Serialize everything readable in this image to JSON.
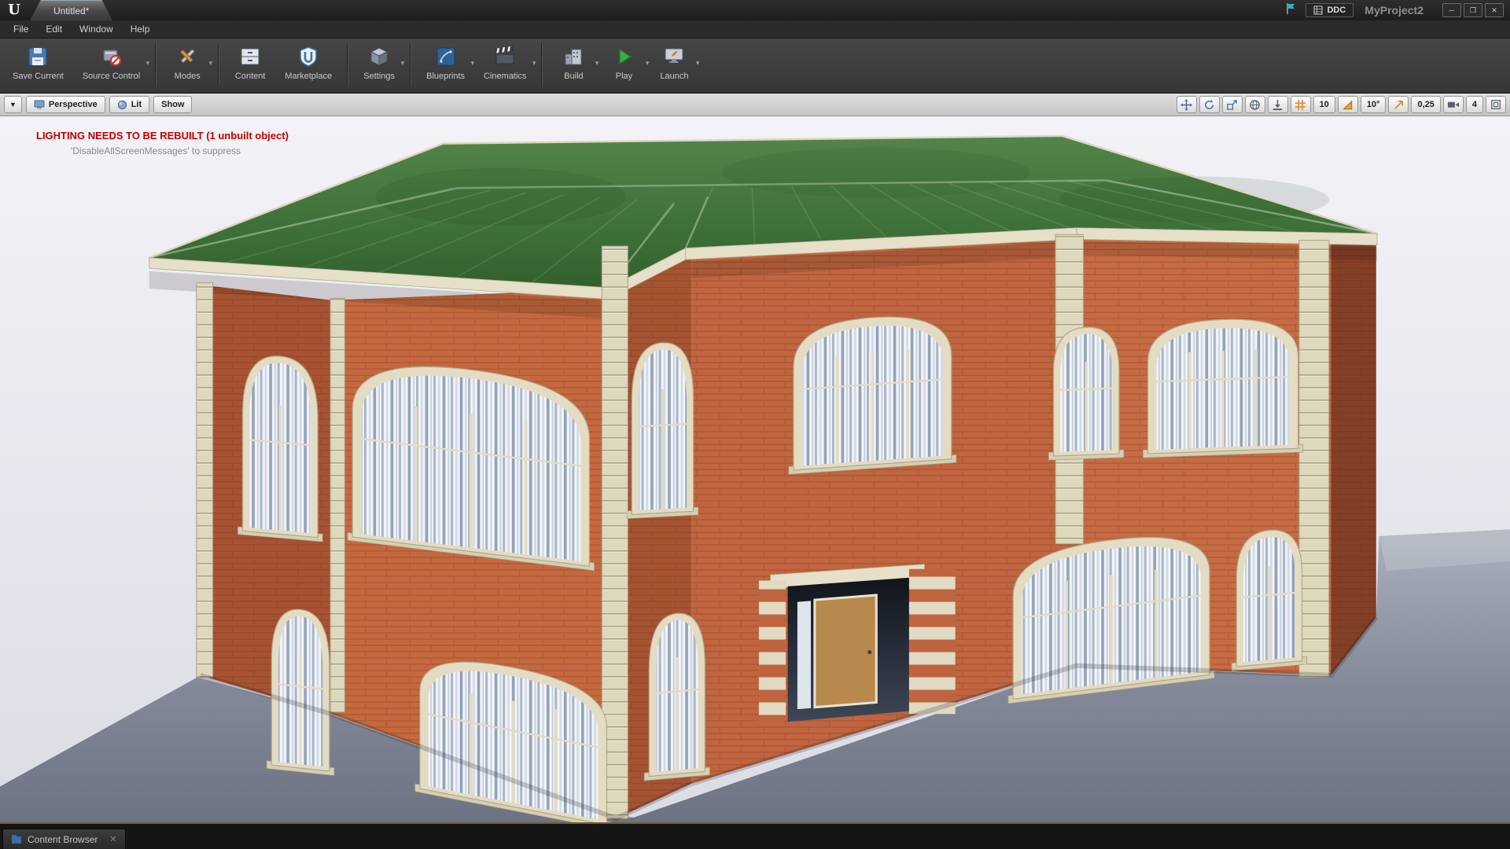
{
  "window": {
    "tab_title": "Untitled*",
    "ddc_label": "DDC",
    "project_name": "MyProject2",
    "controls": {
      "minimize": "─",
      "restore": "❐",
      "close": "✕"
    }
  },
  "menu": {
    "items": [
      "File",
      "Edit",
      "Window",
      "Help"
    ]
  },
  "toolbar": {
    "buttons": [
      {
        "label": "Save Current"
      },
      {
        "label": "Source Control"
      },
      {
        "label": "Modes"
      },
      {
        "label": "Content"
      },
      {
        "label": "Marketplace"
      },
      {
        "label": "Settings"
      },
      {
        "label": "Blueprints"
      },
      {
        "label": "Cinematics"
      },
      {
        "label": "Build"
      },
      {
        "label": "Play"
      },
      {
        "label": "Launch"
      }
    ]
  },
  "viewport": {
    "camera_mode": "Perspective",
    "view_mode": "Lit",
    "show_menu": "Show",
    "warning_primary": "LIGHTING NEEDS TO BE REBUILT (1 unbuilt object)",
    "warning_secondary": "'DisableAllScreenMessages' to suppress",
    "grid_snap_value": "10",
    "rotation_snap_value": "10°",
    "scale_snap_value": "0,25",
    "camera_speed_value": "4"
  },
  "bottom": {
    "content_browser_label": "Content Browser"
  },
  "colors": {
    "warning_red": "#c00000",
    "snap_orange": "#e0862a",
    "roof_green": "#3c6b36",
    "brick_orange": "#c0653f"
  }
}
